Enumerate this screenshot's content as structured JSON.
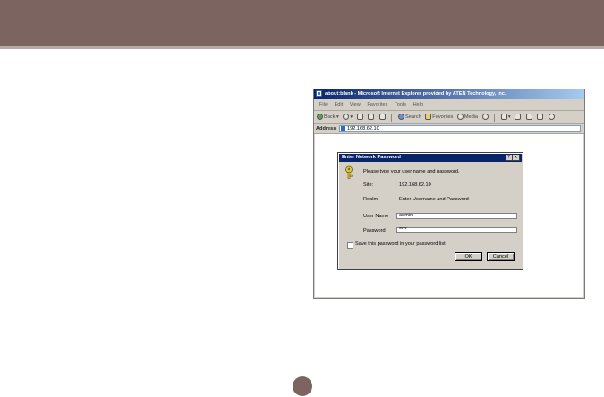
{
  "browser": {
    "title": "about:blank - Microsoft Internet Explorer provided by ATEN Technology, Inc.",
    "menu": [
      "File",
      "Edit",
      "View",
      "Favorites",
      "Tools",
      "Help"
    ],
    "toolbar": {
      "back_label": "Back",
      "search_label": "Search",
      "favorites_label": "Favorites",
      "media_label": "Media"
    },
    "address_label": "Address",
    "address_value": "192.168.62.10"
  },
  "dialog": {
    "title": "Enter Network Password",
    "help_label": "?",
    "close_label": "x",
    "prompt": "Please type your user name and password.",
    "site_label": "Site:",
    "site_value": "192.168.62.10",
    "realm_label": "Realm",
    "realm_value": "Enter Username and Password",
    "username_label": "User Name",
    "username_value": "admin",
    "password_label": "Password",
    "password_value": "****",
    "save_password_label": "Save this password in your password list",
    "save_password_checked": false,
    "ok_label": "OK",
    "cancel_label": "Cancel"
  },
  "colors": {
    "band": "#7c6560",
    "titlebar": "#0a246a",
    "chrome": "#d4d0c8"
  }
}
